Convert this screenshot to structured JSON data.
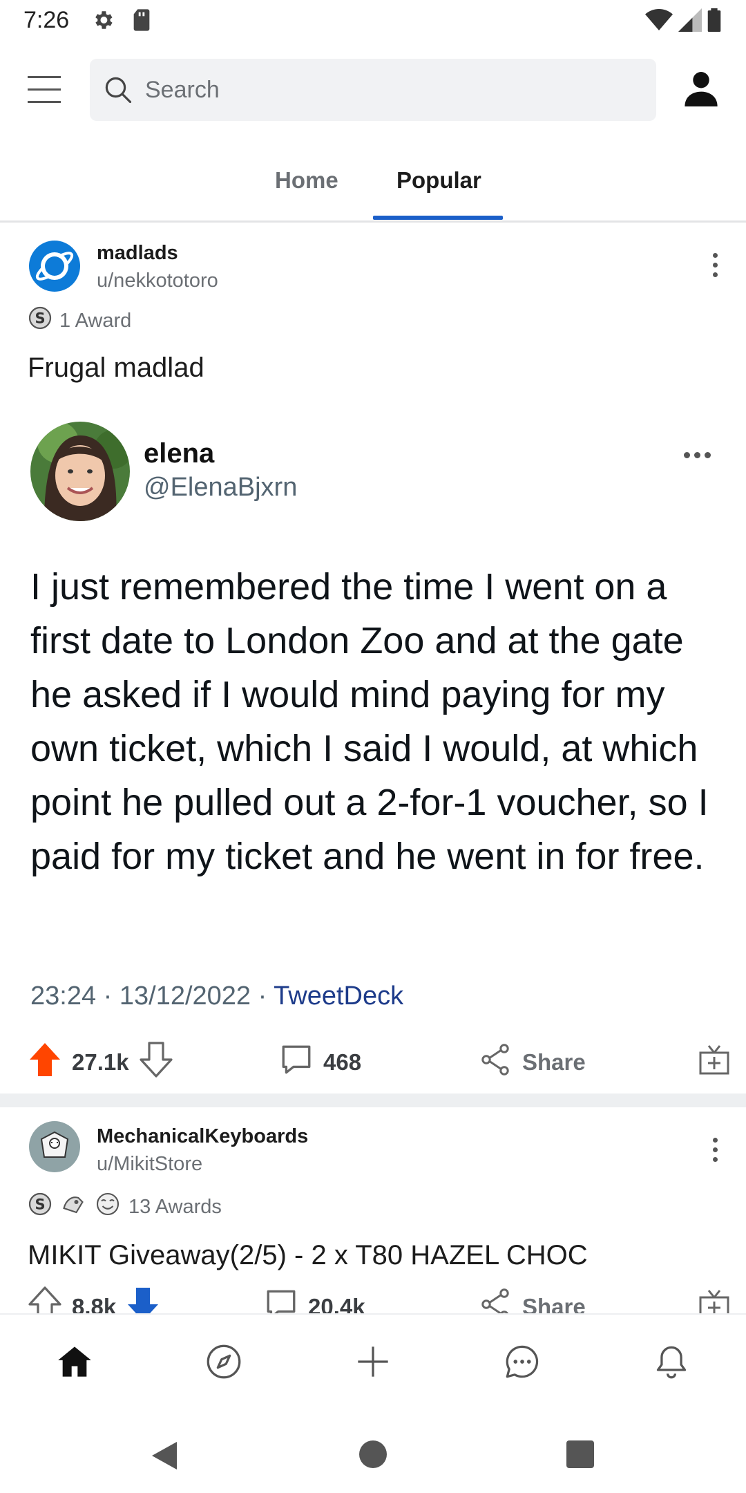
{
  "status_bar": {
    "time": "7:26"
  },
  "search": {
    "placeholder": "Search"
  },
  "tabs": [
    {
      "label": "Home"
    },
    {
      "label": "Popular"
    }
  ],
  "posts": [
    {
      "subreddit": "madlads",
      "user": "u/nekkototoro",
      "awards": "1 Award",
      "title": "Frugal madlad",
      "tweet": {
        "name": "elena",
        "handle": "@ElenaBjxrn",
        "text": "I just remembered the time I went on a first date to London Zoo and at the gate he asked if I would mind paying for my own ticket, which I said I would, at which point he pulled out a 2-for-1 voucher, so I paid for my ticket and he went in for free.",
        "meta": "23:24 · 13/12/2022 · ",
        "source": "TweetDeck"
      },
      "votes": "27.1k",
      "comments": "468",
      "share": "Share"
    },
    {
      "subreddit": "MechanicalKeyboards",
      "user": "u/MikitStore",
      "awards": "13 Awards",
      "title": "MIKIT Giveaway(2/5) - 2 x T80 HAZEL CHOC",
      "votes": "8.8k",
      "comments": "20.4k",
      "share": "Share"
    }
  ],
  "colors": {
    "upvote_active": "#ff4500",
    "downvote_active": "#1b5fc9",
    "accent_blue": "#1b5fc9"
  }
}
